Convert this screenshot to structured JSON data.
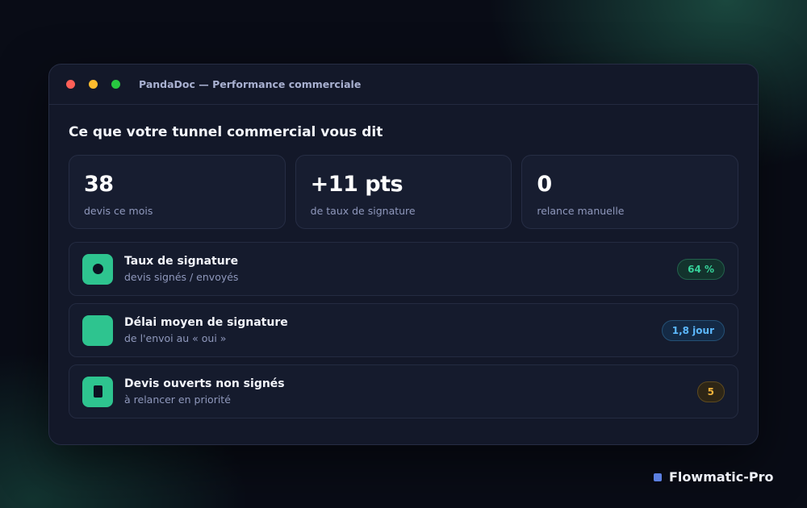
{
  "window": {
    "title": "PandaDoc — Performance commerciale"
  },
  "main": {
    "heading": "Ce que votre tunnel commercial vous dit",
    "stats": [
      {
        "value": "38",
        "label": "devis ce mois"
      },
      {
        "value": "+11 pts",
        "label": "de taux de signature"
      },
      {
        "value": "0",
        "label": "relance manuelle"
      }
    ],
    "rows": [
      {
        "title": "Taux de signature",
        "subtitle": "devis signés / envoyés",
        "badge": "64 %",
        "icon": "target-icon"
      },
      {
        "title": "Délai moyen de signature",
        "subtitle": "de l'envoi au « oui »",
        "badge": "1,8 jour",
        "icon": "clock-icon"
      },
      {
        "title": "Devis ouverts non signés",
        "subtitle": "à relancer en priorité",
        "badge": "5",
        "icon": "document-icon"
      }
    ]
  },
  "brand": {
    "name": "Flowmatic-Pro"
  },
  "colors": {
    "accent": "#2ec48f",
    "badge_green": "#36d39a",
    "badge_blue": "#5cb8ff",
    "badge_amber": "#f2b43c",
    "brand": "#5b7fe0"
  }
}
